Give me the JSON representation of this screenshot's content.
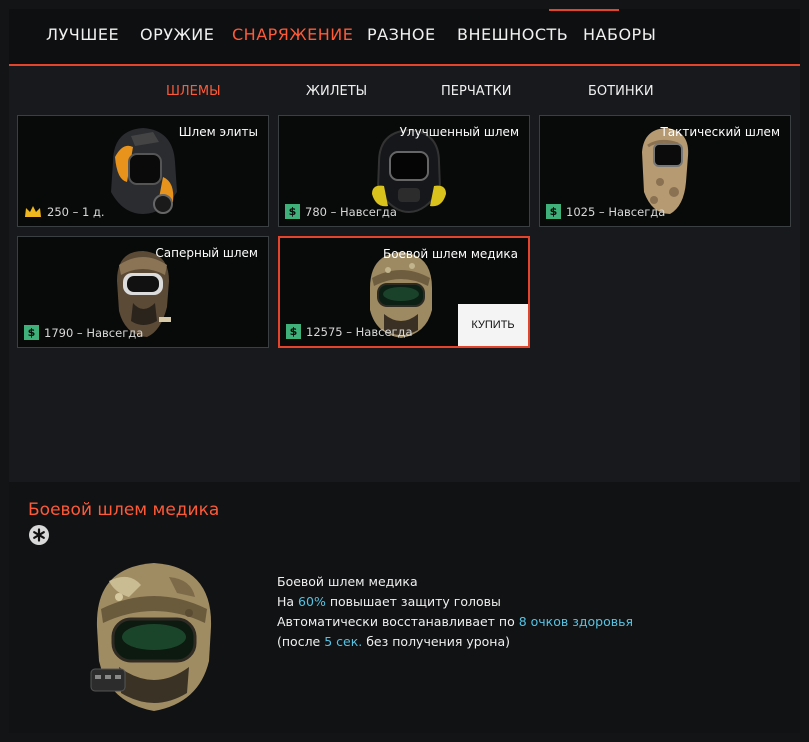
{
  "nav": {
    "tabs": [
      {
        "label": "ЛУЧШЕЕ"
      },
      {
        "label": "ОРУЖИЕ"
      },
      {
        "label": "СНАРЯЖЕНИЕ"
      },
      {
        "label": "РАЗНОЕ"
      },
      {
        "label": "ВНЕШНОСТЬ"
      },
      {
        "label": "НАБОРЫ"
      }
    ],
    "active_index": 2
  },
  "subnav": {
    "tabs": [
      {
        "label": "ШЛЕМЫ"
      },
      {
        "label": "ЖИЛЕТЫ"
      },
      {
        "label": "ПЕРЧАТКИ"
      },
      {
        "label": "БОТИНКИ"
      }
    ],
    "active_index": 0
  },
  "items": [
    {
      "title": "Шлем элиты",
      "price": "250 – 1 д.",
      "currency": "crown"
    },
    {
      "title": "Улучшенный шлем",
      "price": "780 – Навсегда",
      "currency": "money"
    },
    {
      "title": "Тактический шлем",
      "price": "1025 – Навсегда",
      "currency": "money"
    },
    {
      "title": "Саперный шлем",
      "price": "1790 – Навсегда",
      "currency": "money"
    },
    {
      "title": "Боевой шлем медика",
      "price": "12575 – Навсегда",
      "currency": "money",
      "buy_label": "КУПИТЬ"
    }
  ],
  "details": {
    "title": "Боевой шлем медика",
    "name": "Боевой шлем медика",
    "line1": {
      "pre": "На ",
      "hl": "60%",
      "post": " повышает защиту головы"
    },
    "line2": {
      "pre": "Автоматически восстанавливает по ",
      "hl": "8 очков здоровья",
      "post": ""
    },
    "line3": {
      "pre": "(после ",
      "hl": "5 сек.",
      "post": " без получения урона)"
    }
  },
  "colors": {
    "accent": "#e2452c",
    "highlight": "#57c3e3",
    "money": "#3fb07a",
    "crown": "#f0b81e"
  }
}
